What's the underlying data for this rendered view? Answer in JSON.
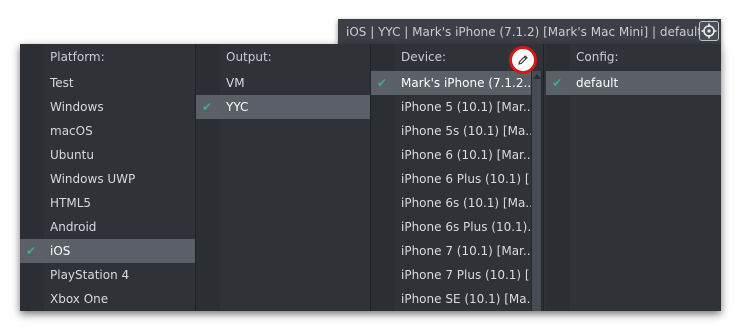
{
  "top_bar": {
    "title": "iOS  |  YYC  |  Mark's iPhone (7.1.2) [Mark's Mac Mini]  |  default"
  },
  "columns": {
    "platform": {
      "header": "Platform:",
      "items": [
        {
          "label": "Test",
          "selected": false
        },
        {
          "label": "Windows",
          "selected": false
        },
        {
          "label": "macOS",
          "selected": false
        },
        {
          "label": "Ubuntu",
          "selected": false
        },
        {
          "label": "Windows UWP",
          "selected": false
        },
        {
          "label": "HTML5",
          "selected": false
        },
        {
          "label": "Android",
          "selected": false
        },
        {
          "label": "iOS",
          "selected": true
        },
        {
          "label": "PlayStation 4",
          "selected": false
        },
        {
          "label": "Xbox One",
          "selected": false
        }
      ]
    },
    "output": {
      "header": "Output:",
      "items": [
        {
          "label": "VM",
          "selected": false
        },
        {
          "label": "YYC",
          "selected": true
        }
      ]
    },
    "device": {
      "header": "Device:",
      "items": [
        {
          "label": "Mark's iPhone (7.1.2...",
          "selected": true
        },
        {
          "label": "iPhone 5 (10.1) [Mar...",
          "selected": false
        },
        {
          "label": "iPhone 5s (10.1) [Ma...",
          "selected": false
        },
        {
          "label": "iPhone 6 (10.1) [Mar...",
          "selected": false
        },
        {
          "label": "iPhone 6 Plus (10.1) [...",
          "selected": false
        },
        {
          "label": "iPhone 6s (10.1) [Ma...",
          "selected": false
        },
        {
          "label": "iPhone 6s Plus (10.1)...",
          "selected": false
        },
        {
          "label": "iPhone 7 (10.1) [Mar...",
          "selected": false
        },
        {
          "label": "iPhone 7 Plus (10.1) [...",
          "selected": false
        },
        {
          "label": "iPhone SE (10.1) [Ma...",
          "selected": false
        }
      ]
    },
    "config": {
      "header": "Config:",
      "items": [
        {
          "label": "default",
          "selected": true
        }
      ]
    }
  },
  "icons": {
    "check": "check-icon",
    "target": "target-icon",
    "edit": "pencil-icon"
  },
  "colors": {
    "panel_bg": "#2f3237",
    "selected_bg": "#5b6068",
    "check": "#36b37e",
    "highlight_ring": "#d21818"
  }
}
